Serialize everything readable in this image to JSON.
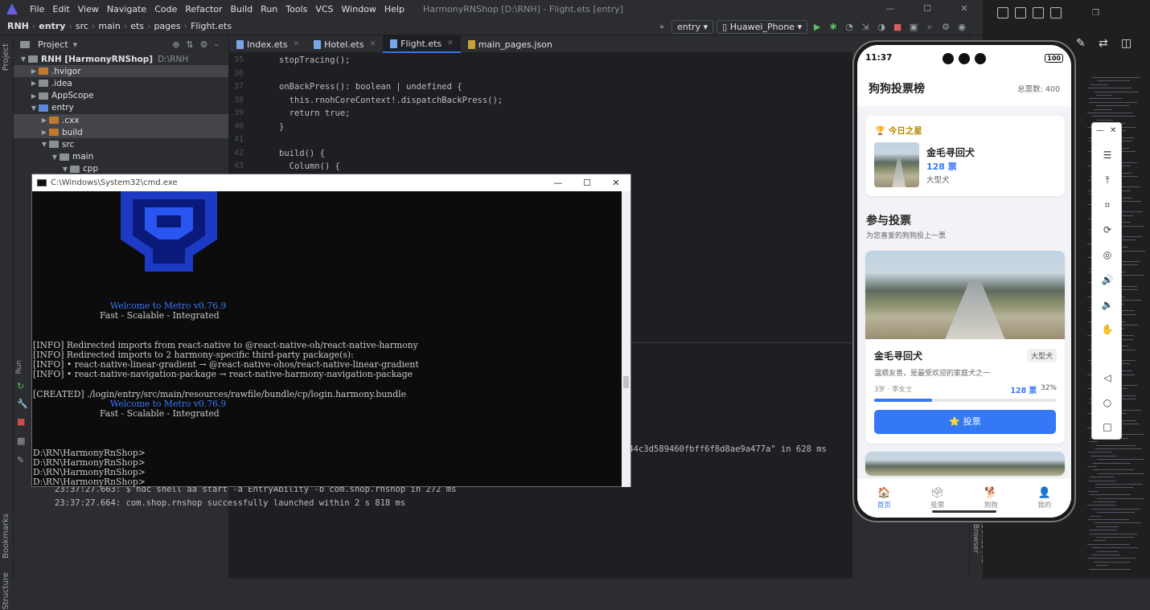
{
  "ide": {
    "menu": [
      "File",
      "Edit",
      "View",
      "Navigate",
      "Code",
      "Refactor",
      "Build",
      "Run",
      "Tools",
      "VCS",
      "Window",
      "Help"
    ],
    "window_title": "HarmonyRNShop [D:\\RNH] - Flight.ets [entry]",
    "breadcrumbs": [
      "RNH",
      "entry",
      "src",
      "main",
      "ets",
      "pages",
      "Flight.ets"
    ],
    "run_config": "entry",
    "device": "Huawei_Phone",
    "project_panel_title": "Project",
    "tree": [
      {
        "label": "RNH [HarmonyRNShop]",
        "extra": "D:\\RNH",
        "indent": 0,
        "arrow": "open",
        "folder": "plain",
        "sel": false
      },
      {
        "label": ".hvigor",
        "extra": "",
        "indent": 1,
        "arrow": "closed",
        "folder": "orange",
        "sel": true
      },
      {
        "label": ".idea",
        "extra": "",
        "indent": 1,
        "arrow": "closed",
        "folder": "plain",
        "sel": false
      },
      {
        "label": "AppScope",
        "extra": "",
        "indent": 1,
        "arrow": "closed",
        "folder": "plain",
        "sel": false
      },
      {
        "label": "entry",
        "extra": "",
        "indent": 1,
        "arrow": "open",
        "folder": "blue",
        "sel": false
      },
      {
        "label": ".cxx",
        "extra": "",
        "indent": 2,
        "arrow": "closed",
        "folder": "orange",
        "sel": true
      },
      {
        "label": "build",
        "extra": "",
        "indent": 2,
        "arrow": "closed",
        "folder": "orange",
        "sel": true
      },
      {
        "label": "src",
        "extra": "",
        "indent": 2,
        "arrow": "open",
        "folder": "plain",
        "sel": false
      },
      {
        "label": "main",
        "extra": "",
        "indent": 3,
        "arrow": "open",
        "folder": "plain",
        "sel": false
      },
      {
        "label": "cpp",
        "extra": "",
        "indent": 4,
        "arrow": "open",
        "folder": "plain",
        "sel": false
      }
    ],
    "tabs": [
      {
        "label": "Index.ets",
        "type": "ets",
        "active": false
      },
      {
        "label": "Hotel.ets",
        "type": "ets",
        "active": false
      },
      {
        "label": "Flight.ets",
        "type": "ets",
        "active": true
      },
      {
        "label": "main_pages.json",
        "type": "json",
        "active": false
      }
    ],
    "code_lines": [
      {
        "n": "35",
        "text": "stopTracing();"
      },
      {
        "n": "36",
        "text": ""
      },
      {
        "n": "37",
        "text": "onBackPress(): boolean | undefined {"
      },
      {
        "n": "38",
        "text": "  this.rnohCoreContext!.dispatchBackPress();"
      },
      {
        "n": "39",
        "text": "  return true;"
      },
      {
        "n": "40",
        "text": "}"
      },
      {
        "n": "41",
        "text": ""
      },
      {
        "n": "42",
        "text": "build() {"
      },
      {
        "n": "43",
        "text": "  Column() {"
      }
    ],
    "run_label": "Run",
    "log_lines": [
      "c44c3d589460fbff6f8d8ae9a477a\" in 628 ms",
      "23:37:27.663: $ hdc shell aa start -a EntryAbility -b com.shop.rnshop in 272 ms",
      "23:37:27.664: com.shop.rnshop successfully launched within 2 s 818 ms"
    ],
    "left_strip_labels": [
      "Project",
      "Bookmarks",
      "Structure"
    ],
    "right_strip_label": "Device File Browser"
  },
  "cmd": {
    "title": "C:\\Windows\\System32\\cmd.exe",
    "welcome_1": "Welcome to Metro v0.76.9",
    "tagline_1": "Fast - Scalable - Integrated",
    "info_1": "[INFO] Redirected imports from react-native to @react-native-oh/react-native-harmony",
    "info_2": "[INFO] Redirected imports to 2 harmony-specific third-party package(s):",
    "info_3": "[INFO] • react-native-linear-gradient → @react-native-ohos/react-native-linear-gradient",
    "info_4": "[INFO] • react-native-navigation-package → react-native-harmony-navigation-package",
    "created": "[CREATED] ./login/entry/src/main/resources/rawfile/bundle/cp/login.harmony.bundle",
    "welcome_2": "Welcome to Metro v0.76.9",
    "tagline_2": "Fast - Scalable - Integrated",
    "prompts": [
      "D:\\RN\\HarmonyRnShop>",
      "D:\\RN\\HarmonyRnShop>",
      "D:\\RN\\HarmonyRnShop>",
      "D:\\RN\\HarmonyRnShop>"
    ]
  },
  "phone": {
    "time": "11:37",
    "battery": "100",
    "app_title": "狗狗投票榜",
    "total_votes": "总票数: 400",
    "star_header": "今日之星",
    "star_icon": "trophy-icon",
    "star_name": "金毛寻回犬",
    "star_votes": "128 票",
    "star_size": "大型犬",
    "section_title": "参与投票",
    "section_sub": "为您喜爱的狗狗投上一票",
    "dog": {
      "name": "金毛寻回犬",
      "tag": "大型犬",
      "desc": "温顺友善，是最受欢迎的家庭犬之一",
      "meta": "3岁 · 李女士",
      "votes": "128 票",
      "percent": "32%",
      "progress": 0.32,
      "vote_button": "⭐ 投票"
    },
    "tabbar": [
      {
        "label": "首页",
        "icon": "home-icon",
        "glyph": "🏠",
        "on": true
      },
      {
        "label": "投票",
        "icon": "ballot-icon",
        "glyph": "🗳",
        "on": false
      },
      {
        "label": "狗狗",
        "icon": "dog-icon",
        "glyph": "🐕",
        "on": false
      },
      {
        "label": "我的",
        "icon": "person-icon",
        "glyph": "👤",
        "on": false
      }
    ],
    "accent": "#3478f6"
  },
  "emulator_tools": [
    {
      "name": "menu-icon",
      "glyph": "☰"
    },
    {
      "name": "pin-top-icon",
      "glyph": "⤒"
    },
    {
      "name": "crop-icon",
      "glyph": "⌗"
    },
    {
      "name": "rotate-icon",
      "glyph": "⟳"
    },
    {
      "name": "location-icon",
      "glyph": "◎"
    },
    {
      "name": "volume-up-icon",
      "glyph": "🔊"
    },
    {
      "name": "volume-down-icon",
      "glyph": "🔉"
    },
    {
      "name": "shake-icon",
      "glyph": "✋"
    },
    {
      "name": "back-icon",
      "glyph": "◁"
    },
    {
      "name": "home-icon",
      "glyph": "○"
    },
    {
      "name": "overview-icon",
      "glyph": "□"
    }
  ]
}
